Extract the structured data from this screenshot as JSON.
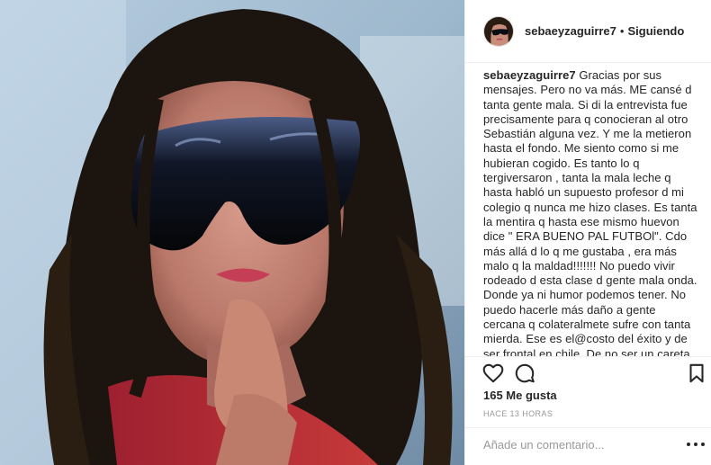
{
  "post": {
    "username": "sebaeyzaguirre7",
    "follow_separator": "•",
    "follow_status": "Siguiendo",
    "caption_username": "sebaeyzaguirre7",
    "caption_text": "Gracias por sus mensajes. Pero no va más. ME cansé d tanta gente mala. Si di la entrevista fue precisamente para q conocieran al otro Sebastián alguna vez. Y me la metieron hasta el fondo. Me siento como si me hubieran cogido. Es tanto lo q tergiversaron , tanta la mala leche q hasta habló un supuesto profesor d mi colegio q nunca me hizo clases. Es tanta la mentira q hasta ese mismo huevon dice \" ERA BUENO PAL FUTBOl\". Cdo más allá d lo q me gustaba , era más malo q la maldad!!!!!!! No puedo vivir rodeado d esta clase d gente mala onda. Donde ya ni humor podemos tener. No puedo hacerle más daño a gente cercana q colateralmete sufre con tanta mierda. Ese es el@costo del éxito y de ser frontal en chile. De no ser un careta. Pero yo no puedo ni quiero. También tengo mi corazón.",
    "likes": "165 Me gusta",
    "timestamp": "HACE 13 HORAS",
    "comment_placeholder": "Añade un comentario..."
  },
  "icons": {
    "like": "heart-icon",
    "comment": "comment-bubble-icon",
    "save": "bookmark-icon",
    "more": "more-options-icon"
  },
  "colors": {
    "text": "#262626",
    "muted": "#999999",
    "border": "#efefef"
  }
}
